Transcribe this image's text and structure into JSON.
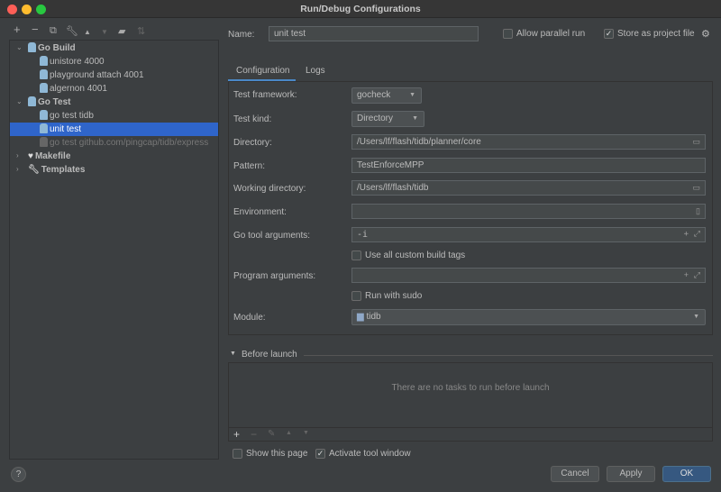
{
  "window": {
    "title": "Run/Debug Configurations"
  },
  "toolbar": {
    "icons": [
      "plus-icon",
      "minus-icon",
      "copy-icon",
      "wrench-icon",
      "arrow-up-icon",
      "arrow-down-icon",
      "folder-add-icon",
      "sort-icon"
    ]
  },
  "tree": {
    "groups": [
      {
        "label": "Go Build",
        "items": [
          "unistore 4000",
          "playground attach 4001",
          "algernon 4001"
        ]
      },
      {
        "label": "Go Test",
        "items": [
          "go test tidb",
          "unit test",
          "go test github.com/pingcap/tidb/express"
        ]
      },
      {
        "label": "Makefile"
      },
      {
        "label": "Templates"
      }
    ],
    "selected": "unit test"
  },
  "header": {
    "name_label": "Name:",
    "name_value": "unit test",
    "allow_parallel": "Allow parallel run",
    "allow_parallel_checked": false,
    "store_project": "Store as project file",
    "store_project_checked": true
  },
  "tabs": [
    {
      "label": "Configuration",
      "active": true
    },
    {
      "label": "Logs",
      "active": false
    }
  ],
  "form": {
    "test_framework": {
      "label": "Test framework:",
      "value": "gocheck"
    },
    "test_kind": {
      "label": "Test kind:",
      "value": "Directory"
    },
    "directory": {
      "label": "Directory:",
      "value": "/Users/lf/flash/tidb/planner/core"
    },
    "pattern": {
      "label": "Pattern:",
      "value": "TestEnforceMPP"
    },
    "working_directory": {
      "label": "Working directory:",
      "value": "/Users/lf/flash/tidb"
    },
    "environment": {
      "label": "Environment:",
      "value": ""
    },
    "go_tool_arguments": {
      "label": "Go tool arguments:",
      "value": "-i"
    },
    "custom_tags": {
      "label": "Use all custom build tags",
      "checked": false
    },
    "program_arguments": {
      "label": "Program arguments:",
      "value": ""
    },
    "sudo": {
      "label": "Run with sudo",
      "checked": false
    },
    "module": {
      "label": "Module:",
      "value": "tidb"
    }
  },
  "before_launch": {
    "title": "Before launch",
    "empty": "There are no tasks to run before launch"
  },
  "footer": {
    "show_page": "Show this page",
    "show_page_checked": false,
    "activate_tool": "Activate tool window",
    "activate_tool_checked": true,
    "help": "?",
    "cancel": "Cancel",
    "apply": "Apply",
    "ok": "OK"
  },
  "colors": {
    "accent": "#2f65ca",
    "ok": "#365880",
    "bg": "#3c3f41"
  }
}
